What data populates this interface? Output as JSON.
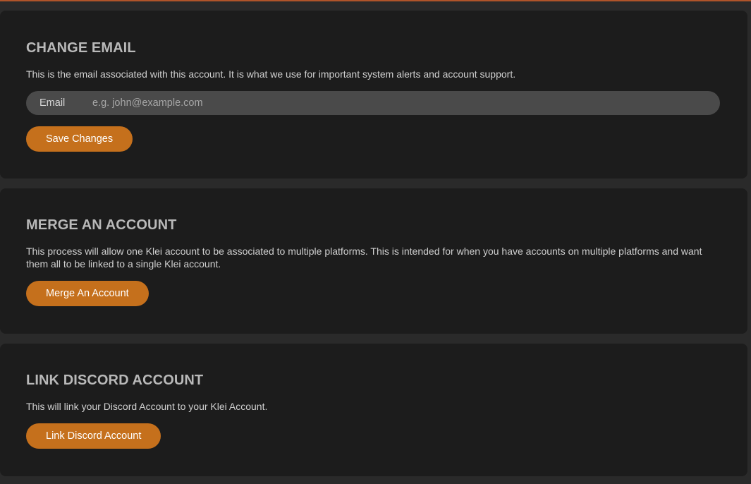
{
  "change_email": {
    "title": "CHANGE EMAIL",
    "description": "This is the email associated with this account. It is what we use for important system alerts and account support.",
    "field_label": "Email",
    "field_value": "",
    "field_placeholder": "e.g. john@example.com",
    "button_label": "Save Changes"
  },
  "merge_account": {
    "title": "MERGE AN ACCOUNT",
    "description": "This process will allow one Klei account to be associated to multiple platforms. This is intended for when you have accounts on multiple platforms and want them all to be linked to a single Klei account.",
    "button_label": "Merge An Account"
  },
  "link_discord": {
    "title": "LINK DISCORD ACCOUNT",
    "description": "This will link your Discord Account to your Klei Account.",
    "button_label": "Link Discord Account"
  },
  "colors": {
    "accent": "#c5701c",
    "panel_bg": "#1c1c1c",
    "page_bg": "#2a2a2a",
    "title_text": "#b9b9b9",
    "field_bg": "#4a4a4a"
  }
}
